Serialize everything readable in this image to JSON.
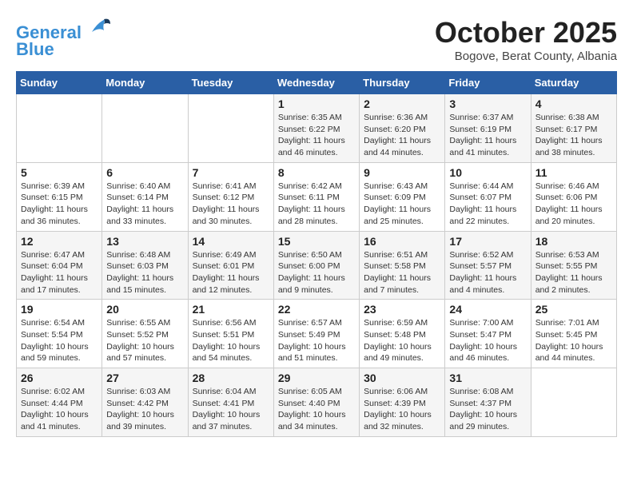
{
  "header": {
    "logo_line1": "General",
    "logo_line2": "Blue",
    "month": "October 2025",
    "location": "Bogove, Berat County, Albania"
  },
  "weekdays": [
    "Sunday",
    "Monday",
    "Tuesday",
    "Wednesday",
    "Thursday",
    "Friday",
    "Saturday"
  ],
  "weeks": [
    [
      {
        "day": "",
        "info": ""
      },
      {
        "day": "",
        "info": ""
      },
      {
        "day": "",
        "info": ""
      },
      {
        "day": "1",
        "info": "Sunrise: 6:35 AM\nSunset: 6:22 PM\nDaylight: 11 hours\nand 46 minutes."
      },
      {
        "day": "2",
        "info": "Sunrise: 6:36 AM\nSunset: 6:20 PM\nDaylight: 11 hours\nand 44 minutes."
      },
      {
        "day": "3",
        "info": "Sunrise: 6:37 AM\nSunset: 6:19 PM\nDaylight: 11 hours\nand 41 minutes."
      },
      {
        "day": "4",
        "info": "Sunrise: 6:38 AM\nSunset: 6:17 PM\nDaylight: 11 hours\nand 38 minutes."
      }
    ],
    [
      {
        "day": "5",
        "info": "Sunrise: 6:39 AM\nSunset: 6:15 PM\nDaylight: 11 hours\nand 36 minutes."
      },
      {
        "day": "6",
        "info": "Sunrise: 6:40 AM\nSunset: 6:14 PM\nDaylight: 11 hours\nand 33 minutes."
      },
      {
        "day": "7",
        "info": "Sunrise: 6:41 AM\nSunset: 6:12 PM\nDaylight: 11 hours\nand 30 minutes."
      },
      {
        "day": "8",
        "info": "Sunrise: 6:42 AM\nSunset: 6:11 PM\nDaylight: 11 hours\nand 28 minutes."
      },
      {
        "day": "9",
        "info": "Sunrise: 6:43 AM\nSunset: 6:09 PM\nDaylight: 11 hours\nand 25 minutes."
      },
      {
        "day": "10",
        "info": "Sunrise: 6:44 AM\nSunset: 6:07 PM\nDaylight: 11 hours\nand 22 minutes."
      },
      {
        "day": "11",
        "info": "Sunrise: 6:46 AM\nSunset: 6:06 PM\nDaylight: 11 hours\nand 20 minutes."
      }
    ],
    [
      {
        "day": "12",
        "info": "Sunrise: 6:47 AM\nSunset: 6:04 PM\nDaylight: 11 hours\nand 17 minutes."
      },
      {
        "day": "13",
        "info": "Sunrise: 6:48 AM\nSunset: 6:03 PM\nDaylight: 11 hours\nand 15 minutes."
      },
      {
        "day": "14",
        "info": "Sunrise: 6:49 AM\nSunset: 6:01 PM\nDaylight: 11 hours\nand 12 minutes."
      },
      {
        "day": "15",
        "info": "Sunrise: 6:50 AM\nSunset: 6:00 PM\nDaylight: 11 hours\nand 9 minutes."
      },
      {
        "day": "16",
        "info": "Sunrise: 6:51 AM\nSunset: 5:58 PM\nDaylight: 11 hours\nand 7 minutes."
      },
      {
        "day": "17",
        "info": "Sunrise: 6:52 AM\nSunset: 5:57 PM\nDaylight: 11 hours\nand 4 minutes."
      },
      {
        "day": "18",
        "info": "Sunrise: 6:53 AM\nSunset: 5:55 PM\nDaylight: 11 hours\nand 2 minutes."
      }
    ],
    [
      {
        "day": "19",
        "info": "Sunrise: 6:54 AM\nSunset: 5:54 PM\nDaylight: 10 hours\nand 59 minutes."
      },
      {
        "day": "20",
        "info": "Sunrise: 6:55 AM\nSunset: 5:52 PM\nDaylight: 10 hours\nand 57 minutes."
      },
      {
        "day": "21",
        "info": "Sunrise: 6:56 AM\nSunset: 5:51 PM\nDaylight: 10 hours\nand 54 minutes."
      },
      {
        "day": "22",
        "info": "Sunrise: 6:57 AM\nSunset: 5:49 PM\nDaylight: 10 hours\nand 51 minutes."
      },
      {
        "day": "23",
        "info": "Sunrise: 6:59 AM\nSunset: 5:48 PM\nDaylight: 10 hours\nand 49 minutes."
      },
      {
        "day": "24",
        "info": "Sunrise: 7:00 AM\nSunset: 5:47 PM\nDaylight: 10 hours\nand 46 minutes."
      },
      {
        "day": "25",
        "info": "Sunrise: 7:01 AM\nSunset: 5:45 PM\nDaylight: 10 hours\nand 44 minutes."
      }
    ],
    [
      {
        "day": "26",
        "info": "Sunrise: 6:02 AM\nSunset: 4:44 PM\nDaylight: 10 hours\nand 41 minutes."
      },
      {
        "day": "27",
        "info": "Sunrise: 6:03 AM\nSunset: 4:42 PM\nDaylight: 10 hours\nand 39 minutes."
      },
      {
        "day": "28",
        "info": "Sunrise: 6:04 AM\nSunset: 4:41 PM\nDaylight: 10 hours\nand 37 minutes."
      },
      {
        "day": "29",
        "info": "Sunrise: 6:05 AM\nSunset: 4:40 PM\nDaylight: 10 hours\nand 34 minutes."
      },
      {
        "day": "30",
        "info": "Sunrise: 6:06 AM\nSunset: 4:39 PM\nDaylight: 10 hours\nand 32 minutes."
      },
      {
        "day": "31",
        "info": "Sunrise: 6:08 AM\nSunset: 4:37 PM\nDaylight: 10 hours\nand 29 minutes."
      },
      {
        "day": "",
        "info": ""
      }
    ]
  ]
}
